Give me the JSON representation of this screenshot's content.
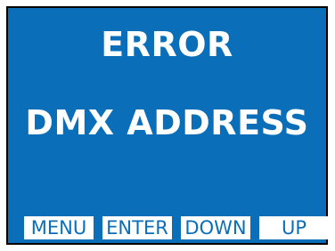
{
  "display": {
    "line1": "ERROR",
    "line2": "DMX ADDRESS"
  },
  "softkeys": {
    "menu": "MENU",
    "enter": "ENTER",
    "down": "DOWN",
    "up": "UP"
  },
  "colors": {
    "background": "#0a6fb8",
    "text": "#ffffff",
    "key_bg": "#ffffff",
    "key_text": "#0a6fb8"
  }
}
